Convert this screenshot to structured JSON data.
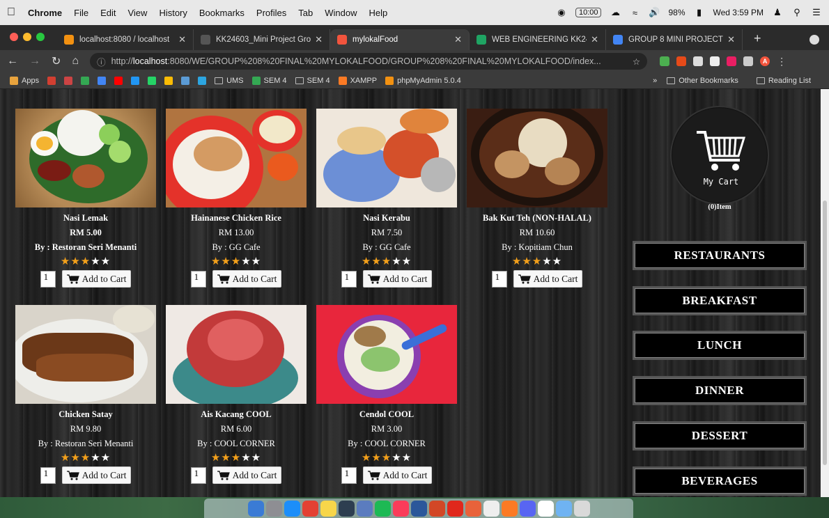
{
  "menubar": {
    "app": "Chrome",
    "items": [
      "File",
      "Edit",
      "View",
      "History",
      "Bookmarks",
      "Profiles",
      "Tab",
      "Window",
      "Help"
    ],
    "time_box": "10:00",
    "battery": "98%",
    "clock": "Wed 3:59 PM"
  },
  "tabs": [
    {
      "label": "localhost:8080 / localhost",
      "color": "#f29111"
    },
    {
      "label": "KK24603_Mini Project Gro",
      "color": "#555555"
    },
    {
      "label": "mylokalFood",
      "color": "#f2543d"
    },
    {
      "label": "WEB ENGINEERING KK246",
      "color": "#1fa463"
    },
    {
      "label": "GROUP 8 MINI PROJECT",
      "color": "#4285f4"
    }
  ],
  "address": {
    "prefix": "http://",
    "host": "localhost",
    "path": ":8080/WE/GROUP%208%20FINAL%20MYLOKALFOOD/GROUP%208%20FINAL%20MYLOKALFOOD/index..."
  },
  "bookmarks": {
    "apps": "Apps",
    "items": [
      "UMS",
      "SEM 4",
      "SEM 4",
      "XAMPP",
      "phpMyAdmin 5.0.4"
    ],
    "other": "Other Bookmarks",
    "reading": "Reading List"
  },
  "cart": {
    "label": "My Cart",
    "count": "(0)Item"
  },
  "categories": [
    "RESTAURANTS",
    "BREAKFAST",
    "LUNCH",
    "DINNER",
    "DESSERT",
    "BEVERAGES"
  ],
  "products": [
    {
      "name": "Nasi Lemak",
      "price": "RM 5.00",
      "by": "By : Restoran Seri Menanti",
      "rating": 3,
      "qty": "1",
      "add_label": "Add to Cart"
    },
    {
      "name": "Hainanese Chicken Rice",
      "price": "RM 13.00",
      "by": "By : GG Cafe",
      "rating": 3,
      "qty": "1",
      "add_label": "Add to Cart"
    },
    {
      "name": "Nasi Kerabu",
      "price": "RM 7.50",
      "by": "By : GG Cafe",
      "rating": 3,
      "qty": "1",
      "add_label": "Add to Cart"
    },
    {
      "name": "Bak Kut Teh (NON-HALAL)",
      "price": "RM 10.60",
      "by": "By : Kopitiam Chun",
      "rating": 3,
      "qty": "1",
      "add_label": "Add to Cart"
    },
    {
      "name": "Chicken Satay",
      "price": "RM 9.80",
      "by": "By : Restoran Seri Menanti",
      "rating": 3,
      "qty": "1",
      "add_label": "Add to Cart"
    },
    {
      "name": "Ais Kacang COOL",
      "price": "RM 6.00",
      "by": "By : COOL CORNER",
      "rating": 3,
      "qty": "1",
      "add_label": "Add to Cart"
    },
    {
      "name": "Cendol COOL",
      "price": "RM 3.00",
      "by": "By : COOL CORNER",
      "rating": 3,
      "qty": "1",
      "add_label": "Add to Cart"
    }
  ]
}
